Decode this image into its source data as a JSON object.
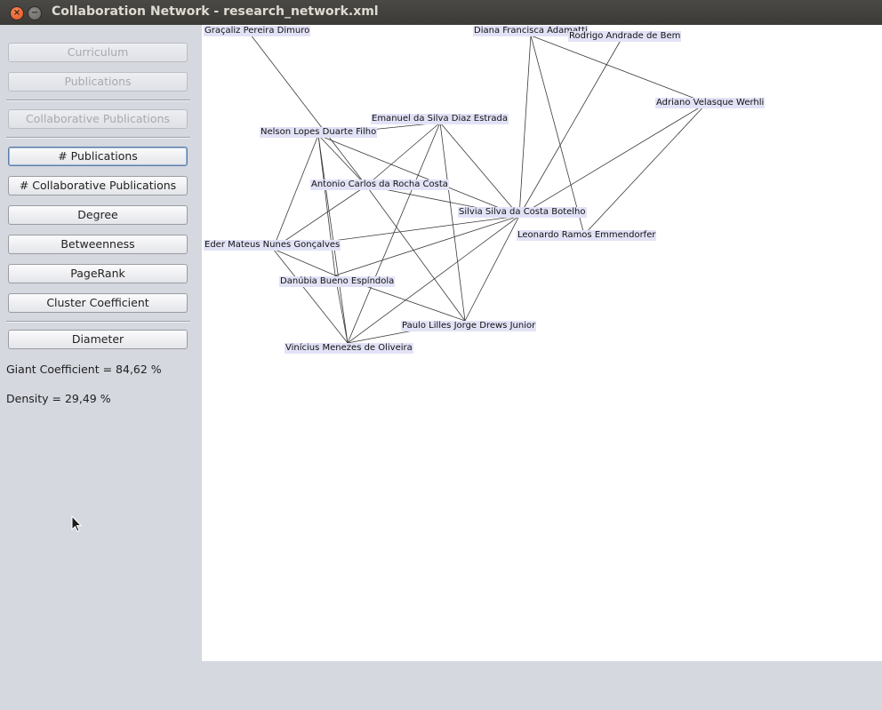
{
  "window": {
    "title": "Collaboration Network - research_network.xml",
    "close_glyph": "×",
    "minimize_glyph": "−"
  },
  "sidebar": {
    "view_buttons": [
      "Curriculum",
      "Publications",
      "Collaborative Publications"
    ],
    "metric_buttons": [
      "# Publications",
      "# Collaborative Publications",
      "Degree",
      "Betweenness",
      "PageRank",
      "Cluster Coefficient"
    ],
    "diameter_button": "Diameter",
    "giant_coefficient": "Giant Coefficient = 84,62 %",
    "density": "Density = 29,49 %"
  },
  "graph": {
    "nodes": [
      {
        "id": "graca",
        "label": "Graçaliz Pereira Dimuro"
      },
      {
        "id": "diana",
        "label": "Diana Francisca Adamatti"
      },
      {
        "id": "rodrigo",
        "label": "Rodrigo Andrade de Bem"
      },
      {
        "id": "adriano",
        "label": "Adriano Velasque Werhli"
      },
      {
        "id": "emanuel",
        "label": "Emanuel da Silva Diaz Estrada"
      },
      {
        "id": "nelson",
        "label": "Nelson Lopes Duarte Filho"
      },
      {
        "id": "antonio",
        "label": "Antonio Carlos da Rocha Costa"
      },
      {
        "id": "silvia",
        "label": "Silvia Silva da Costa Botelho"
      },
      {
        "id": "leonardo",
        "label": "Leonardo Ramos Emmendorfer"
      },
      {
        "id": "eder",
        "label": "Eder Mateus Nunes Gonçalves"
      },
      {
        "id": "danubia",
        "label": "Danúbia Bueno Espíndola"
      },
      {
        "id": "paulo",
        "label": "Paulo Lilles Jorge Drews Junior"
      },
      {
        "id": "vinicius",
        "label": "Vinícius Menezes de Oliveira"
      }
    ],
    "edges": [
      [
        "graca",
        "antonio"
      ],
      [
        "diana",
        "silvia"
      ],
      [
        "diana",
        "leonardo"
      ],
      [
        "diana",
        "adriano"
      ],
      [
        "rodrigo",
        "silvia"
      ],
      [
        "adriano",
        "silvia"
      ],
      [
        "adriano",
        "leonardo"
      ],
      [
        "emanuel",
        "nelson"
      ],
      [
        "emanuel",
        "antonio"
      ],
      [
        "emanuel",
        "silvia"
      ],
      [
        "emanuel",
        "paulo"
      ],
      [
        "emanuel",
        "vinicius"
      ],
      [
        "nelson",
        "antonio"
      ],
      [
        "nelson",
        "silvia"
      ],
      [
        "nelson",
        "eder"
      ],
      [
        "nelson",
        "danubia"
      ],
      [
        "nelson",
        "vinicius"
      ],
      [
        "antonio",
        "silvia"
      ],
      [
        "antonio",
        "eder"
      ],
      [
        "antonio",
        "paulo"
      ],
      [
        "silvia",
        "eder"
      ],
      [
        "silvia",
        "danubia"
      ],
      [
        "silvia",
        "vinicius"
      ],
      [
        "silvia",
        "paulo"
      ],
      [
        "eder",
        "danubia"
      ],
      [
        "eder",
        "vinicius"
      ],
      [
        "danubia",
        "paulo"
      ],
      [
        "danubia",
        "vinicius"
      ],
      [
        "paulo",
        "vinicius"
      ]
    ]
  }
}
